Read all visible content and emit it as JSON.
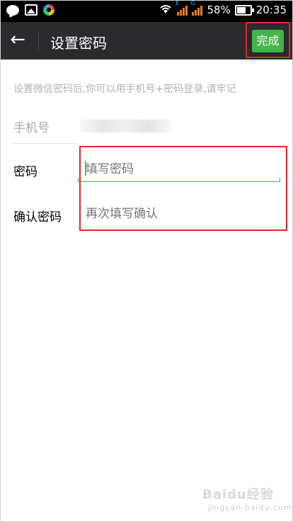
{
  "status_bar": {
    "battery": "58%",
    "time": "20:35"
  },
  "app_bar": {
    "title": "设置密码",
    "done_label": "完成"
  },
  "hint_text": "设置微信密码后,你可以用手机号+密码登录,请牢记",
  "form": {
    "phone_label": "手机号",
    "password_label": "密码",
    "password_placeholder": "填写密码",
    "confirm_label": "确认密码",
    "confirm_placeholder": "再次填写确认"
  },
  "watermark": {
    "brand": "Baidu经验",
    "url": "jingyan.baidu.com"
  },
  "colors": {
    "accent": "#44b549",
    "appbar": "#2a2a2f",
    "highlight": "#e32626"
  }
}
